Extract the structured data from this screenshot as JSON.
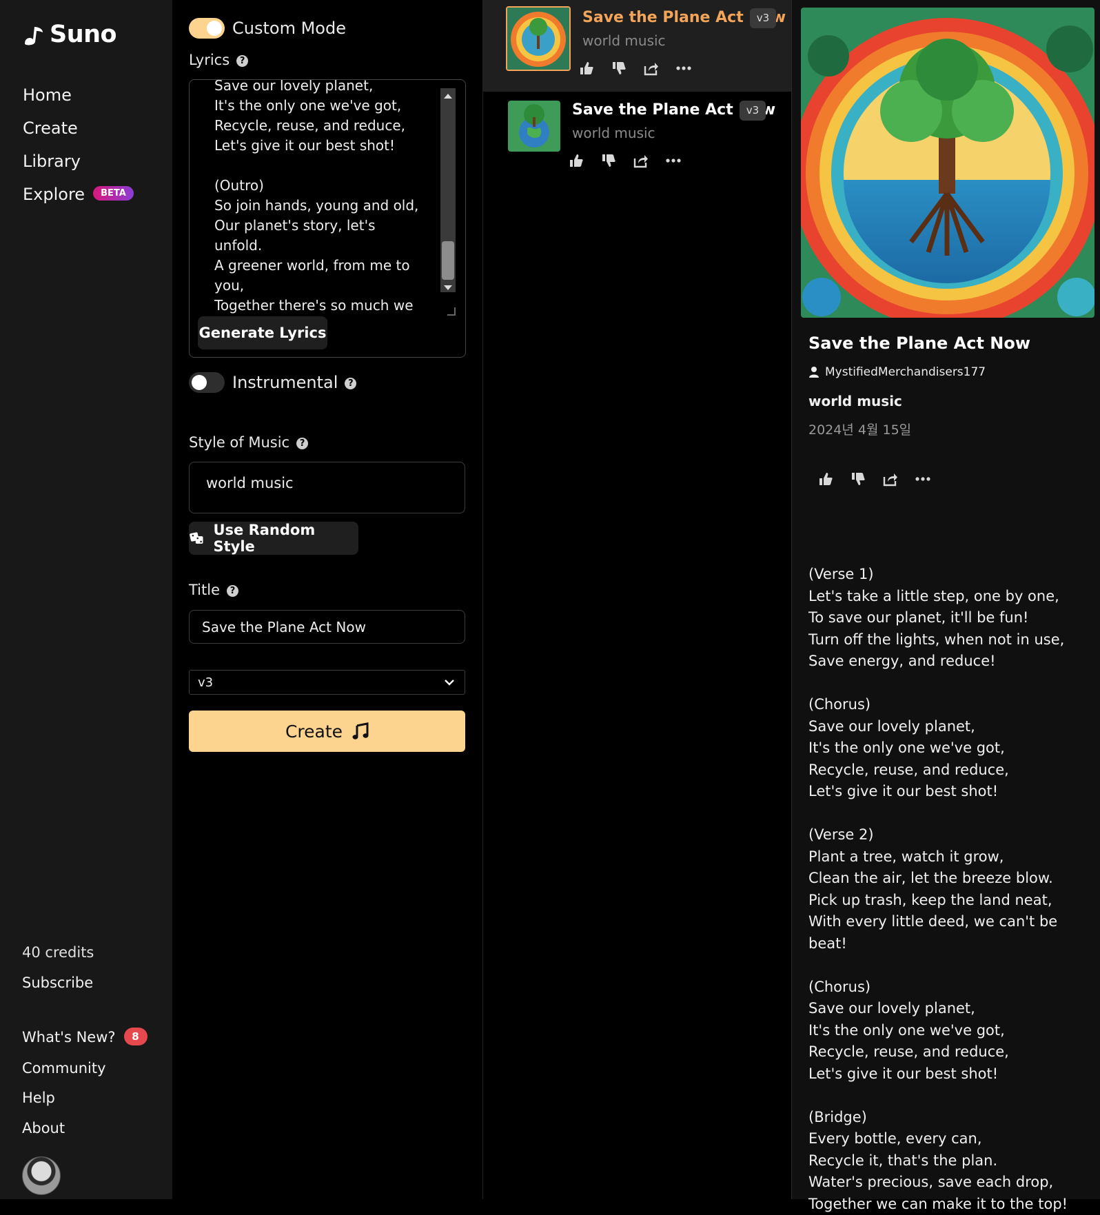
{
  "sidebar": {
    "logo_text": "Suno",
    "nav": [
      "Home",
      "Create",
      "Library",
      "Explore"
    ],
    "explore_badge": "BETA",
    "credits": "40 credits",
    "subscribe": "Subscribe",
    "whats_new": "What's New?",
    "whats_new_count": "8",
    "community": "Community",
    "help": "Help",
    "about": "About"
  },
  "create": {
    "custom_mode_label": "Custom Mode",
    "custom_mode_on": true,
    "lyrics_label": "Lyrics",
    "lyrics_text": "Save our lovely planet,\nIt's the only one we've got,\nRecycle, reuse, and reduce,\nLet's give it our best shot!\n\n(Outro)\nSo join hands, young and old,\nOur planet's story, let's unfold.\nA greener world, from me to you,\nTogether there's so much we can do!",
    "generate_lyrics": "Generate Lyrics",
    "instrumental_label": "Instrumental",
    "instrumental_on": false,
    "style_label": "Style of Music",
    "style_value": "world music",
    "random_style": "Use Random Style",
    "title_label": "Title",
    "title_value": "Save the Plane Act Now",
    "version_value": "v3",
    "create_button": "Create"
  },
  "songs": [
    {
      "title": "Save the Plane Act Now",
      "style": "world music",
      "version": "v3",
      "active": true
    },
    {
      "title": "Save the Plane Act Now",
      "style": "world music",
      "version": "v3",
      "active": false
    }
  ],
  "details": {
    "title": "Save the Plane Act Now",
    "author": "MystifiedMerchandisers177",
    "style": "world music",
    "date": "2024년 4월 15일",
    "lyrics": "(Verse 1)\nLet's take a little step, one by one,\nTo save our planet, it'll be fun!\nTurn off the lights, when not in use,\nSave energy, and reduce!\n\n(Chorus)\nSave our lovely planet,\nIt's the only one we've got,\nRecycle, reuse, and reduce,\nLet's give it our best shot!\n\n(Verse 2)\nPlant a tree, watch it grow,\nClean the air, let the breeze blow.\nPick up trash, keep the land neat,\nWith every little deed, we can't be beat!\n\n(Chorus)\nSave our lovely planet,\nIt's the only one we've got,\nRecycle, reuse, and reduce,\nLet's give it our best shot!\n\n(Bridge)\nEvery bottle, every can,\nRecycle it, that's the plan.\nWater's precious, save each drop,\nTogether we can make it to the top!"
  },
  "colors": {
    "accent": "#fcd38f",
    "active_title": "#f2a458",
    "badge_red": "#e5484d",
    "sidebar_bg": "#181818"
  },
  "icons": [
    "suno-logo-icon",
    "help-icon",
    "dice-icon",
    "music-note-icon",
    "chevron-down-icon",
    "thumbs-up-icon",
    "thumbs-down-icon",
    "share-icon",
    "more-icon",
    "user-icon"
  ]
}
